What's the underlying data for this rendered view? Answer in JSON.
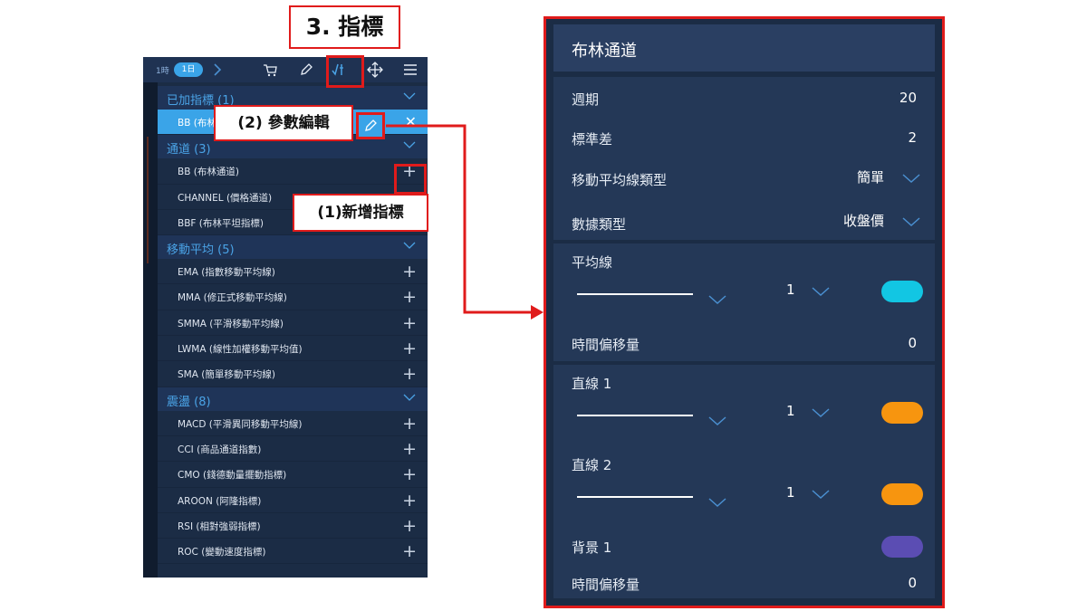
{
  "annotations": {
    "step_title": "3. 指標",
    "edit_param": "(2) 參數編輯",
    "add_indicator": "(1)新增指標"
  },
  "toolbar": {
    "tf_prev": "1時",
    "tf_current": "1日",
    "icons": [
      "cart-icon",
      "pencil-icon",
      "indicator-icon",
      "move-icon",
      "menu-icon"
    ]
  },
  "sections": [
    {
      "title": "已加指標 (1)",
      "items": [
        {
          "label": "BB (布林通道)",
          "action": "close"
        }
      ]
    },
    {
      "title": "通道 (3)",
      "items": [
        {
          "label": "BB (布林通道)",
          "action": "add"
        },
        {
          "label": "CHANNEL (價格通道)",
          "action": "add"
        },
        {
          "label": "BBF (布林平坦指標)",
          "action": "add"
        }
      ]
    },
    {
      "title": "移動平均 (5)",
      "items": [
        {
          "label": "EMA (指數移動平均線)",
          "action": "add"
        },
        {
          "label": "MMA (修正式移動平均線)",
          "action": "add"
        },
        {
          "label": "SMMA (平滑移動平均線)",
          "action": "add"
        },
        {
          "label": "LWMA (線性加權移動平均值)",
          "action": "add"
        },
        {
          "label": "SMA (簡單移動平均線)",
          "action": "add"
        }
      ]
    },
    {
      "title": "震盪 (8)",
      "items": [
        {
          "label": "MACD (平滑異同移動平均線)",
          "action": "add"
        },
        {
          "label": "CCI (商品通道指數)",
          "action": "add"
        },
        {
          "label": "CMO (錢德動量擺動指標)",
          "action": "add"
        },
        {
          "label": "AROON (阿隆指標)",
          "action": "add"
        },
        {
          "label": "RSI (相對強弱指標)",
          "action": "add"
        },
        {
          "label": "ROC (變動速度指標)",
          "action": "add"
        }
      ]
    }
  ],
  "settings": {
    "title": "布林通道",
    "period_label": "週期",
    "period_value": "20",
    "stddev_label": "標準差",
    "stddev_value": "2",
    "ma_type_label": "移動平均線類型",
    "ma_type_value": "簡單",
    "data_type_label": "數據類型",
    "data_type_value": "收盤價",
    "avg_line_label": "平均線",
    "avg_line_width": "1",
    "avg_line_color": "#12c6e3",
    "offset_label": "時間偏移量",
    "offset_value": "0",
    "line1_label": "直線 1",
    "line1_width": "1",
    "line1_color": "#f7950f",
    "line2_label": "直線 2",
    "line2_width": "1",
    "line2_color": "#f7950f",
    "bg1_label": "背景 1",
    "bg1_color": "#5b4db3",
    "offset2_label": "時間偏移量",
    "offset2_value": "0"
  },
  "colors": {
    "annotation_red": "#e01b1b",
    "accent_blue": "#3aa4e8",
    "panel_bg": "#1b2c45"
  }
}
